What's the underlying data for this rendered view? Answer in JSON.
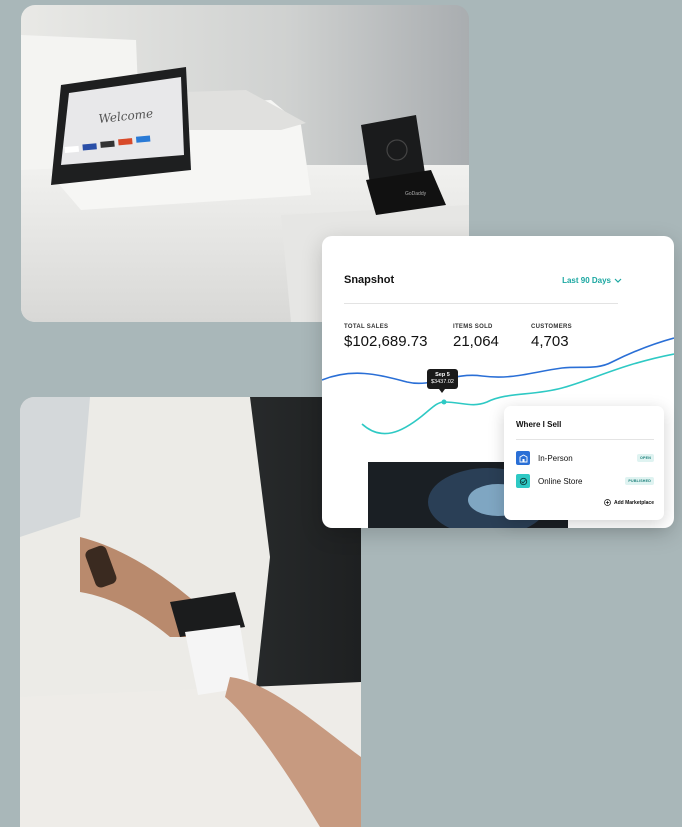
{
  "terminal_photo": {
    "screen_text": "Welcome",
    "reader_brand": "GoDaddy"
  },
  "snapshot": {
    "title": "Snapshot",
    "range_label": "Last 90 Days",
    "stats": [
      {
        "label": "TOTAL SALES",
        "value": "$102,689.73"
      },
      {
        "label": "ITEMS SOLD",
        "value": "21,064"
      },
      {
        "label": "CUSTOMERS",
        "value": "4,703"
      }
    ],
    "tooltip": {
      "date": "Sep 5",
      "amount": "$3437.02"
    },
    "colors": {
      "accent": "#1aa7a1",
      "line_primary": "#2a6fd6",
      "line_secondary": "#2ec9c4"
    }
  },
  "where_i_sell": {
    "title": "Where I Sell",
    "channels": [
      {
        "label": "In-Person",
        "status": "OPEN",
        "icon": "store-icon"
      },
      {
        "label": "Online Store",
        "status": "PUBLISHED",
        "icon": "online-store-icon"
      }
    ],
    "add_label": "Add Marketplace"
  }
}
